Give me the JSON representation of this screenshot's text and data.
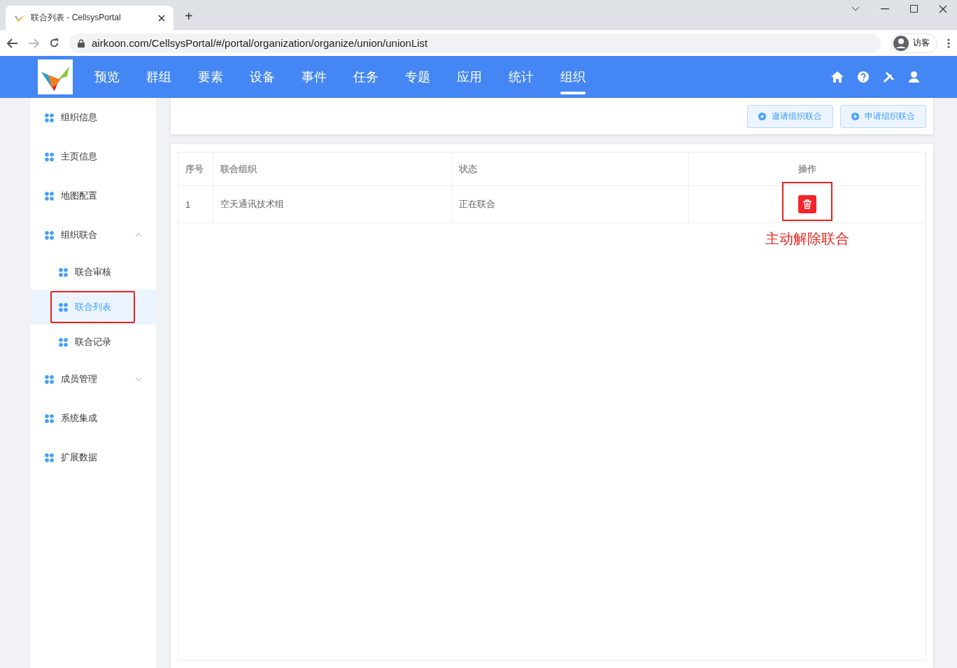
{
  "browser": {
    "tab_title": "联合列表 - CellsysPortal",
    "new_tab": "+",
    "url": "airkoon.com/CellsysPortal/#/portal/organization/organize/union/unionList",
    "profile": "访客"
  },
  "nav": {
    "items": [
      {
        "label": "预览",
        "selected": false
      },
      {
        "label": "群组",
        "selected": false
      },
      {
        "label": "要素",
        "selected": false
      },
      {
        "label": "设备",
        "selected": false
      },
      {
        "label": "事件",
        "selected": false
      },
      {
        "label": "任务",
        "selected": false
      },
      {
        "label": "专题",
        "selected": false
      },
      {
        "label": "应用",
        "selected": false
      },
      {
        "label": "统计",
        "selected": false
      },
      {
        "label": "组织",
        "selected": true
      }
    ]
  },
  "sidebar": {
    "items": [
      {
        "label": "组织信息",
        "selected": false
      },
      {
        "label": "主页信息",
        "selected": false
      },
      {
        "label": "地图配置",
        "selected": false
      },
      {
        "label": "组织联合",
        "selected": false,
        "expanded": true,
        "children": [
          {
            "label": "联合审核",
            "selected": false
          },
          {
            "label": "联合列表",
            "selected": true,
            "highlighted": true
          },
          {
            "label": "联合记录",
            "selected": false
          }
        ]
      },
      {
        "label": "成员管理",
        "selected": false,
        "expanded": false
      },
      {
        "label": "系统集成",
        "selected": false
      },
      {
        "label": "扩展数据",
        "selected": false
      }
    ]
  },
  "toolbar": {
    "buttons": [
      "邀请组织联合",
      "申请组织联合"
    ]
  },
  "table": {
    "columns": [
      "序号",
      "联合组织",
      "状态",
      "操作"
    ],
    "rows": [
      {
        "index": "1",
        "organization": "空天通讯技术组",
        "status": "正在联合",
        "highlighted": true
      }
    ]
  },
  "annotation": "主动解除联合"
}
